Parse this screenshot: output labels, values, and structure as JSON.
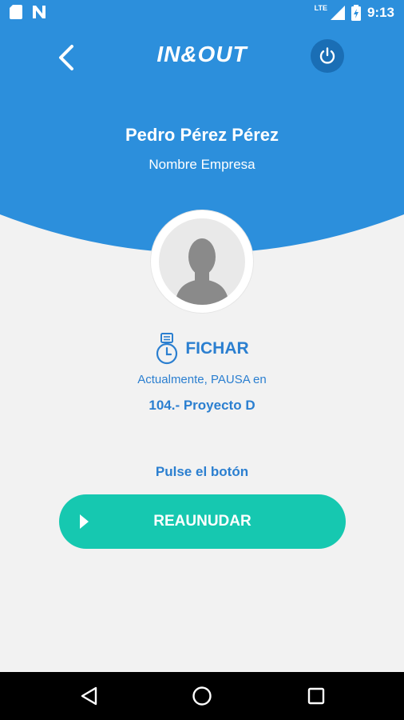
{
  "status_bar": {
    "network_label": "LTE",
    "time": "9:13",
    "icons": [
      "sd-card-icon",
      "n-notification-icon",
      "signal-icon",
      "battery-icon"
    ]
  },
  "header": {
    "logo_text": "IN&OUT",
    "user_name": "Pedro Pérez Pérez",
    "company": "Nombre Empresa"
  },
  "clock": {
    "title": "FICHAR",
    "status_text": "Actualmente, PAUSA en",
    "project": "104.- Proyecto D",
    "prompt": "Pulse el botón",
    "button_label": "REAUNUDAR"
  },
  "colors": {
    "header_blue": "#2c8fdc",
    "accent_teal": "#16c8b0",
    "text_blue": "#2b7fd0",
    "background": "#f2f2f2"
  },
  "nav_bar": {
    "buttons": [
      "back-triangle-icon",
      "home-circle-icon",
      "recents-square-icon"
    ]
  }
}
